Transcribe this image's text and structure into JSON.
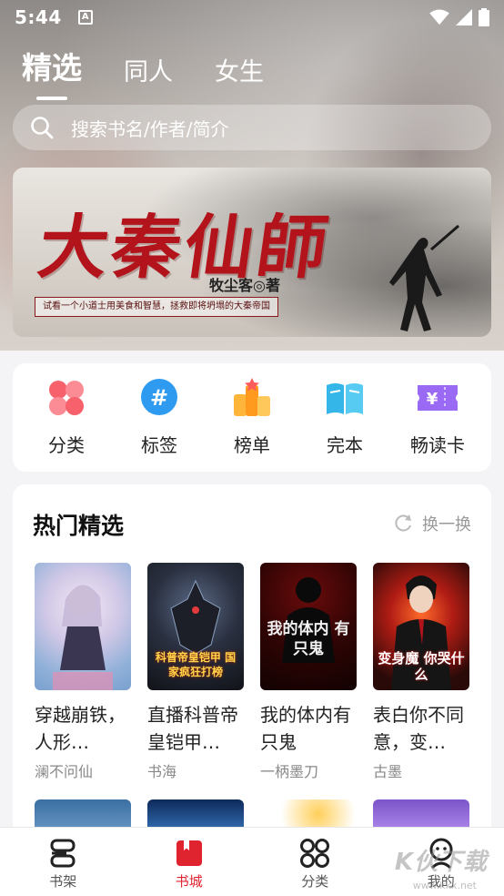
{
  "status_bar": {
    "time": "5:44",
    "notif_letter": "A"
  },
  "top_tabs": [
    {
      "label": "精选",
      "active": true
    },
    {
      "label": "同人",
      "active": false
    },
    {
      "label": "女生",
      "active": false
    }
  ],
  "search": {
    "placeholder": "搜索书名/作者/简介"
  },
  "banner": {
    "title": "大秦仙師",
    "author": "牧尘客◎著",
    "tagline": "试看一个小道士用美食和智慧，拯救即将坍塌的大秦帝国"
  },
  "quick_nav": [
    {
      "label": "分类",
      "icon": "category-clover-icon"
    },
    {
      "label": "标签",
      "icon": "hashtag-tag-icon"
    },
    {
      "label": "榜单",
      "icon": "ranking-star-icon"
    },
    {
      "label": "完本",
      "icon": "open-book-icon"
    },
    {
      "label": "畅读卡",
      "icon": "yuan-ticket-icon"
    }
  ],
  "hot_picks": {
    "title": "热门精选",
    "refresh_label": "换一换",
    "books": [
      {
        "title": "穿越崩铁，人形…",
        "author": "澜不问仙",
        "cover_text": ""
      },
      {
        "title": "直播科普帝皇铠甲…",
        "author": "书海",
        "cover_text": "科普帝皇铠甲 国家疯狂打榜"
      },
      {
        "title": "我的体内有只鬼",
        "author": "一柄墨刀",
        "cover_text": "我的体内 有只鬼"
      },
      {
        "title": "表白你不同意，变…",
        "author": "古墨",
        "cover_text": "变身魔 你哭什么"
      }
    ]
  },
  "bottom_nav": [
    {
      "label": "书架",
      "icon": "bookshelf-icon",
      "active": false
    },
    {
      "label": "书城",
      "icon": "bookstore-icon",
      "active": true
    },
    {
      "label": "分类",
      "icon": "grid-category-icon",
      "active": false
    },
    {
      "label": "我的",
      "icon": "profile-icon",
      "active": false
    }
  ],
  "watermark": {
    "text": "K伙下载",
    "sub": "www.kkx.net"
  },
  "colors": {
    "accent_red": "#e0242f",
    "title_red": "#b3141b"
  }
}
